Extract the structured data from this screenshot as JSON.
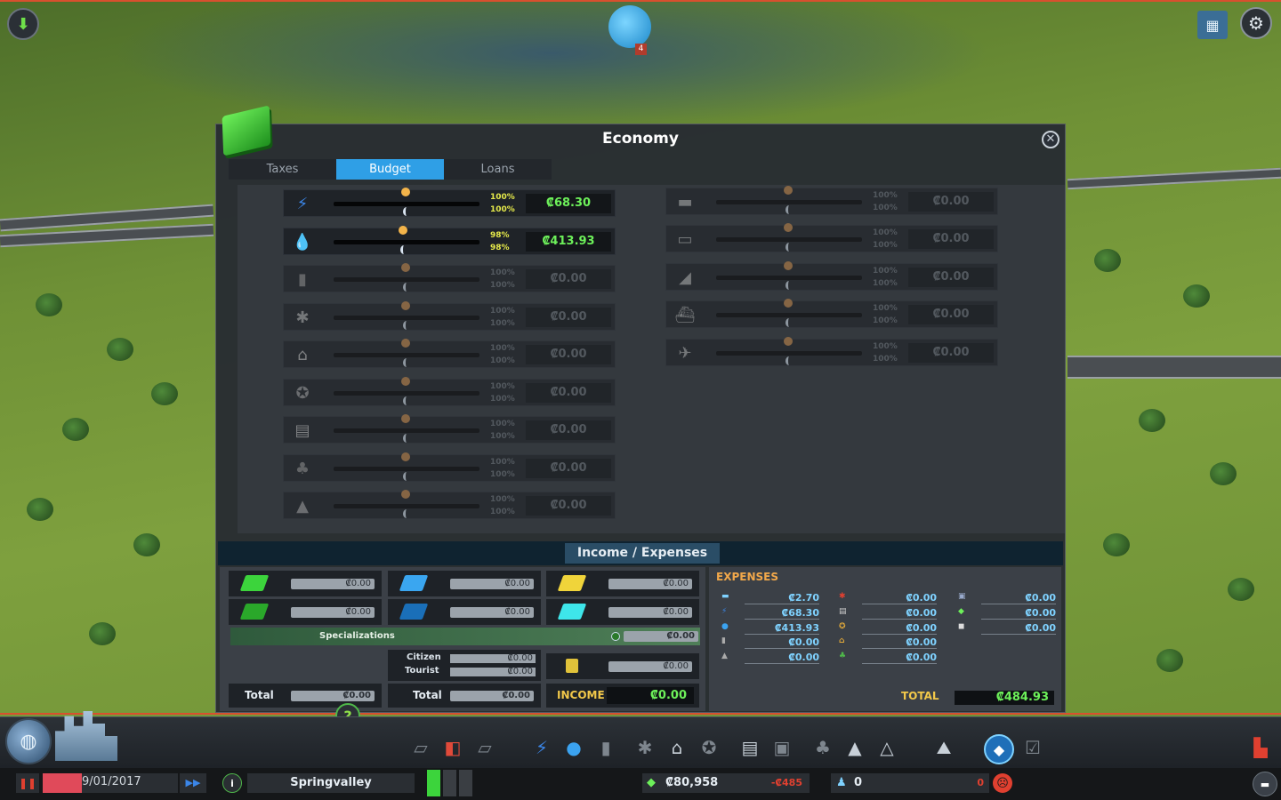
{
  "window": {
    "title": "Economy"
  },
  "tabs": [
    {
      "label": "Taxes",
      "active": false
    },
    {
      "label": "Budget",
      "active": true
    },
    {
      "label": "Loans",
      "active": false
    }
  ],
  "budget_left": [
    {
      "service": "electricity",
      "icon": "lightning-icon",
      "day": "100%",
      "night": "100%",
      "value": "₡68.30",
      "active": true
    },
    {
      "service": "water",
      "icon": "water-drop-icon",
      "day": "98%",
      "night": "98%",
      "value": "₡413.93",
      "active": true
    },
    {
      "service": "garbage",
      "icon": "garbage-bin-icon",
      "day": "100%",
      "night": "100%",
      "value": "₡0.00",
      "active": false
    },
    {
      "service": "healthcare",
      "icon": "healthcare-icon",
      "day": "100%",
      "night": "100%",
      "value": "₡0.00",
      "active": false
    },
    {
      "service": "fire",
      "icon": "fire-helmet-icon",
      "day": "100%",
      "night": "100%",
      "value": "₡0.00",
      "active": false
    },
    {
      "service": "police",
      "icon": "police-badge-icon",
      "day": "100%",
      "night": "100%",
      "value": "₡0.00",
      "active": false
    },
    {
      "service": "education",
      "icon": "book-icon",
      "day": "100%",
      "night": "100%",
      "value": "₡0.00",
      "active": false
    },
    {
      "service": "parks",
      "icon": "tree-icon",
      "day": "100%",
      "night": "100%",
      "value": "₡0.00",
      "active": false
    },
    {
      "service": "monuments",
      "icon": "monument-icon",
      "day": "100%",
      "night": "100%",
      "value": "₡0.00",
      "active": false
    }
  ],
  "budget_right": [
    {
      "service": "bus",
      "icon": "bus-icon",
      "day": "100%",
      "night": "100%",
      "value": "₡0.00"
    },
    {
      "service": "metro",
      "icon": "metro-icon",
      "day": "100%",
      "night": "100%",
      "value": "₡0.00"
    },
    {
      "service": "train",
      "icon": "train-icon",
      "day": "100%",
      "night": "100%",
      "value": "₡0.00"
    },
    {
      "service": "ship",
      "icon": "ship-icon",
      "day": "100%",
      "night": "100%",
      "value": "₡0.00"
    },
    {
      "service": "plane",
      "icon": "plane-icon",
      "day": "100%",
      "night": "100%",
      "value": "₡0.00"
    }
  ],
  "income_expenses": {
    "title": "Income / Expenses",
    "zones": [
      {
        "icon": "residential-low-icon",
        "value": "₡0.00",
        "color": "#3cd43c"
      },
      {
        "icon": "commercial-low-icon",
        "value": "₡0.00",
        "color": "#3aa6f0"
      },
      {
        "icon": "industrial-icon",
        "value": "₡0.00",
        "color": "#f0d43a"
      },
      {
        "icon": "residential-high-icon",
        "value": "₡0.00",
        "color": "#2aa82a"
      },
      {
        "icon": "commercial-high-icon",
        "value": "₡0.00",
        "color": "#1a6fb8"
      },
      {
        "icon": "office-icon",
        "value": "₡0.00",
        "color": "#3ee6ea"
      }
    ],
    "specializations_label": "Specializations",
    "specializations_value": "₡0.00",
    "citizen_label": "Citizen",
    "citizen_value": "₡0.00",
    "tourist_label": "Tourist",
    "tourist_value": "₡0.00",
    "transport_value": "₡0.00",
    "total_label": "Total",
    "total_left_value": "₡0.00",
    "total_mid_value": "₡0.00",
    "income_label": "INCOME",
    "income_value": "₡0.00",
    "expenses_title": "EXPENSES",
    "expenses_col1": [
      "₡2.70",
      "₡68.30",
      "₡413.93",
      "₡0.00",
      "₡0.00"
    ],
    "expenses_col2": [
      "₡0.00",
      "₡0.00",
      "₡0.00",
      "₡0.00",
      "₡0.00"
    ],
    "expenses_col3": [
      "₡0.00",
      "₡0.00",
      "₡0.00"
    ],
    "total_expenses_label": "TOTAL",
    "total_expenses_value": "₡484.93"
  },
  "chirper": {
    "count": "4"
  },
  "status": {
    "date": "9/01/2017",
    "city_name": "Springvalley",
    "money": "₡80,958",
    "money_change": "-₡485",
    "population": "0",
    "population_change": "0"
  },
  "colors": {
    "accent": "#2f9fe6",
    "money_green": "#6df05a",
    "expense_blue": "#7fd2ff",
    "warning_red": "#e04030"
  }
}
